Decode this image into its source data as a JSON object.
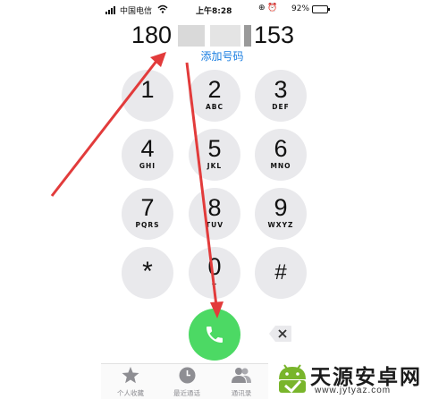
{
  "status_bar": {
    "carrier": "中国电信",
    "time": "上午8:28",
    "icons": "⊕ ⏰",
    "battery_percent": "92%",
    "battery_level": 0.92
  },
  "display": {
    "number_prefix": "180",
    "number_suffix": "153",
    "add_number_label": "添加号码"
  },
  "keypad": [
    {
      "digit": "1",
      "letters": ""
    },
    {
      "digit": "2",
      "letters": "ABC"
    },
    {
      "digit": "3",
      "letters": "DEF"
    },
    {
      "digit": "4",
      "letters": "GHI"
    },
    {
      "digit": "5",
      "letters": "JKL"
    },
    {
      "digit": "6",
      "letters": "MNO"
    },
    {
      "digit": "7",
      "letters": "PQRS"
    },
    {
      "digit": "8",
      "letters": "TUV"
    },
    {
      "digit": "9",
      "letters": "WXYZ"
    },
    {
      "digit": "*",
      "letters": ""
    },
    {
      "digit": "0",
      "letters": "+"
    },
    {
      "digit": "#",
      "letters": ""
    }
  ],
  "tab_bar": {
    "favorites": "个人收藏",
    "recents": "最近通话",
    "contacts": "通讯录"
  },
  "watermark": {
    "title": "天源安卓网",
    "url": "www.jytyaz.com"
  },
  "colors": {
    "call_button": "#4cd964",
    "key_background": "#e9e9ec",
    "link": "#1a7ee0",
    "annotation_arrow": "#e23b3b"
  },
  "icons": [
    "signal-icon",
    "wifi-icon",
    "alarm-icon",
    "battery-icon",
    "phone-icon",
    "backspace-icon",
    "star-icon",
    "clock-icon",
    "contacts-icon"
  ]
}
